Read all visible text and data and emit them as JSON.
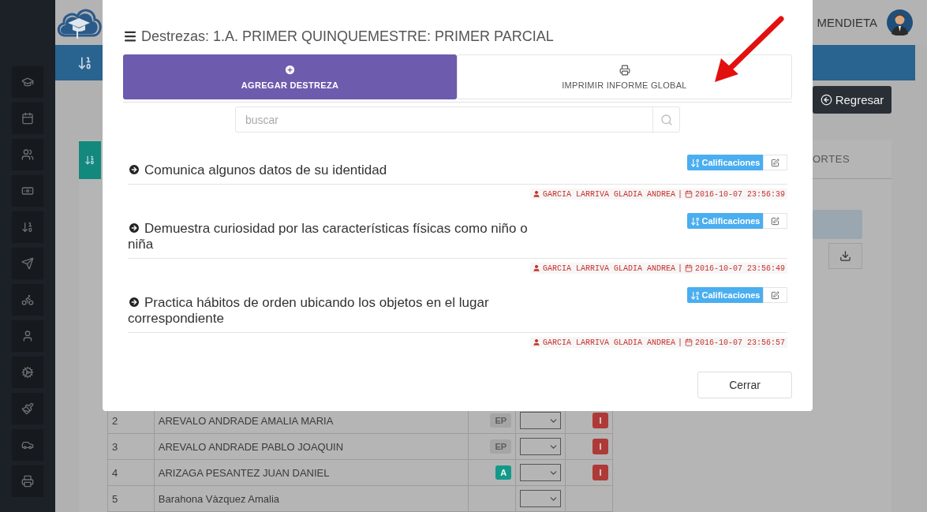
{
  "header": {
    "user_name": "MENDIETA"
  },
  "toolbar": {
    "back_button": "Regresar"
  },
  "panel": {
    "tab_label": "ORTES"
  },
  "students": {
    "rows": [
      {
        "number": "2",
        "name": "AREVALO ANDRADE AMALIA MARIA",
        "grade": {
          "text": "EP",
          "kind": "pending",
          "color": "#a5a5a5"
        },
        "flag": "I"
      },
      {
        "number": "3",
        "name": "AREVALO ANDRADE PABLO JOAQUIN",
        "grade": {
          "text": "EP",
          "kind": "pending",
          "color": "#a5a5a5"
        },
        "flag": "I"
      },
      {
        "number": "4",
        "name": "ARIZAGA PESANTEZ JUAN DANIEL",
        "grade": {
          "text": "A",
          "kind": "achieved",
          "color": "#13998a"
        },
        "flag": "I"
      },
      {
        "number": "5",
        "name": "Barahona Vàzquez Amalia"
      }
    ]
  },
  "modal": {
    "title": "Destrezas: 1.A. PRIMER QUINQUEMESTRE: PRIMER PARCIAL",
    "tabs": [
      {
        "label": "AGREGAR DESTREZA",
        "kind": "add",
        "selected": true
      },
      {
        "label": "IMPRIMIR INFORME GLOBAL",
        "kind": "print",
        "selected": false
      }
    ],
    "search": {
      "placeholder": "buscar"
    },
    "skills": [
      {
        "text": "Comunica algunos datos de su identidad",
        "grades_button": "Calificaciones",
        "author": "GARCIA LARRIVA GLADIA ANDREA",
        "separator": "|",
        "timestamp": "2016-10-07 23:56:39"
      },
      {
        "text": "Demuestra curiosidad por las características físicas como niño o niña",
        "grades_button": "Calificaciones",
        "author": "GARCIA LARRIVA GLADIA ANDREA",
        "separator": "|",
        "timestamp": "2016-10-07 23:56:49"
      },
      {
        "text": "Practica hábitos de orden ubicando los objetos en el lugar correspondiente",
        "grades_button": "Calificaciones",
        "author": "GARCIA LARRIVA GLADIA ANDREA",
        "separator": "|",
        "timestamp": "2016-10-07 23:56:57"
      }
    ],
    "close_button": "Cerrar"
  }
}
